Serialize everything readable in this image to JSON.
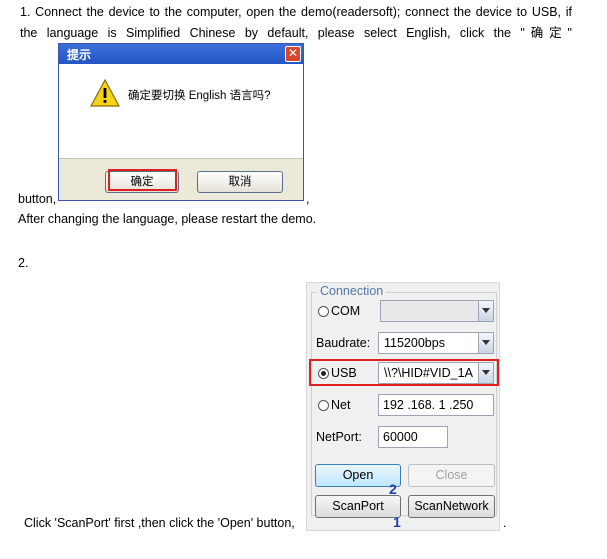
{
  "step1": {
    "line1": "1.  Connect the device to the computer, open the demo(readersoft); connect the device to USB, if",
    "line2": "the  language  is  Simplified  Chinese  by  default,  please  select  English,  click  the  \"确定\"",
    "button_text": "button,",
    "comma": ",",
    "after": "After changing the language, please restart the demo."
  },
  "dialog": {
    "title": "提示",
    "close_glyph": "✕",
    "message": "确定要切换 English 语言吗?",
    "ok_label": "确定",
    "cancel_label": "取消"
  },
  "step2": {
    "number": "2.",
    "instruction": "Click 'ScanPort' first ,then click the 'Open' button,",
    "period": "."
  },
  "connection": {
    "legend": "Connection",
    "com_label": "COM",
    "com_value": "",
    "baudrate_label": "Baudrate:",
    "baudrate_value": "115200bps",
    "usb_label": "USB",
    "usb_value": "\\\\?\\HID#VID_1A",
    "net_label": "Net",
    "ip_value": "192 .168.  1  .250",
    "netport_label": "NetPort:",
    "netport_value": "60000",
    "open_label": "Open",
    "close_label": "Close",
    "scanport_label": "ScanPort",
    "scannetwork_label": "ScanNetwork",
    "badge_1": "1",
    "badge_2": "2"
  },
  "colors": {
    "highlight_red": "#e02020",
    "badge_blue": "#1f3fb0",
    "legend_blue": "#5577aa"
  }
}
